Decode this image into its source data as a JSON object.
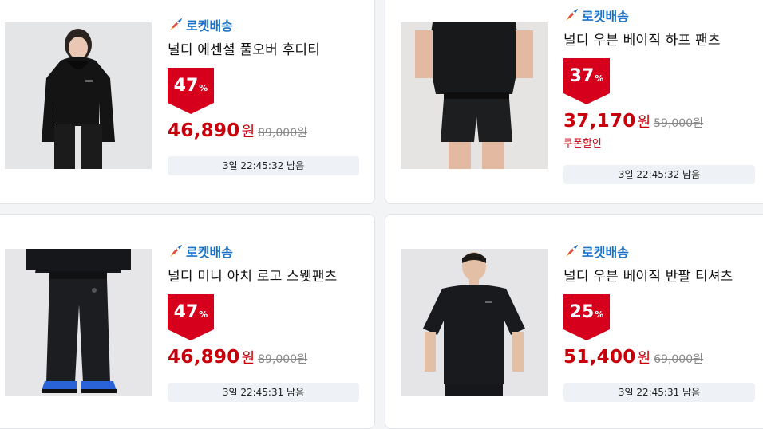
{
  "colors": {
    "accent_blue": "#1a72c7",
    "sale_red": "#c7000b",
    "badge_red": "#d6001c"
  },
  "products": [
    {
      "delivery_label": "로켓배송",
      "delivery_icon": "rocket-icon",
      "title": "널디 에센셜 풀오버 후디티",
      "discount_number": "47",
      "discount_unit": "%",
      "sale_price": "46,890",
      "currency": "원",
      "original_price": "89,000원",
      "coupon_text": "",
      "timer_text": "3일 22:45:32 남음"
    },
    {
      "delivery_label": "로켓배송",
      "delivery_icon": "rocket-icon",
      "title": "널디 우븐 베이직 하프 팬츠",
      "discount_number": "37",
      "discount_unit": "%",
      "sale_price": "37,170",
      "currency": "원",
      "original_price": "59,000원",
      "coupon_text": "쿠폰할인",
      "timer_text": "3일 22:45:32 남음"
    },
    {
      "delivery_label": "로켓배송",
      "delivery_icon": "rocket-icon",
      "title": "널디 미니 아치 로고 스웻팬츠",
      "discount_number": "47",
      "discount_unit": "%",
      "sale_price": "46,890",
      "currency": "원",
      "original_price": "89,000원",
      "coupon_text": "",
      "timer_text": "3일 22:45:31 남음"
    },
    {
      "delivery_label": "로켓배송",
      "delivery_icon": "rocket-icon",
      "title": "널디 우븐 베이직 반팔 티셔츠",
      "discount_number": "25",
      "discount_unit": "%",
      "sale_price": "51,400",
      "currency": "원",
      "original_price": "69,000원",
      "coupon_text": "",
      "timer_text": "3일 22:45:31 남음"
    }
  ]
}
